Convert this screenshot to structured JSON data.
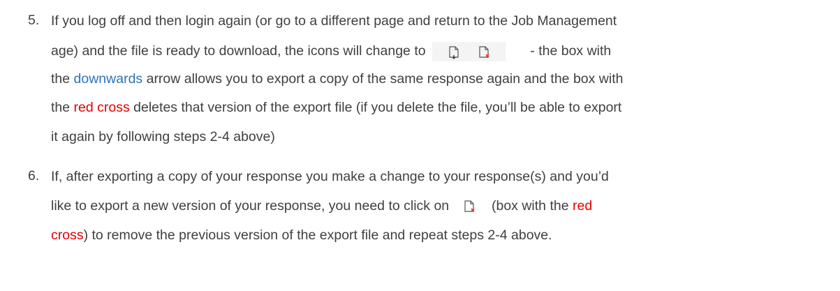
{
  "items": [
    {
      "number": "5.",
      "lines": [
        "If you log off and then login again (or go to a different page and return to the Job Management",
        [
          "age) and the file is ready to download, the icons will change to",
          "- the box with"
        ],
        [
          "the",
          "downwards",
          "arrow allows you to export a copy of the same response again and the box with"
        ],
        [
          "the",
          "red cross",
          "deletes that version of the export file (if you delete the file, you’ll be able to export"
        ],
        "it again by following steps 2-4 above)"
      ]
    },
    {
      "number": "6.",
      "lines": [
        "If, after exporting a copy of your response you make a change to your response(s) and you’d",
        [
          "like to export a new version of your response, you need to click on",
          "(box with the",
          "red"
        ],
        [
          "cross",
          ") to remove the previous version of the export file and repeat steps 2-4 above."
        ]
      ]
    }
  ],
  "icons": {
    "download": "document-download-icon",
    "delete": "document-delete-icon"
  },
  "colors": {
    "text": "#404040",
    "blue_word": "#2e74b5",
    "red_word": "#e60000",
    "icon_background": "#f4f4f4"
  }
}
